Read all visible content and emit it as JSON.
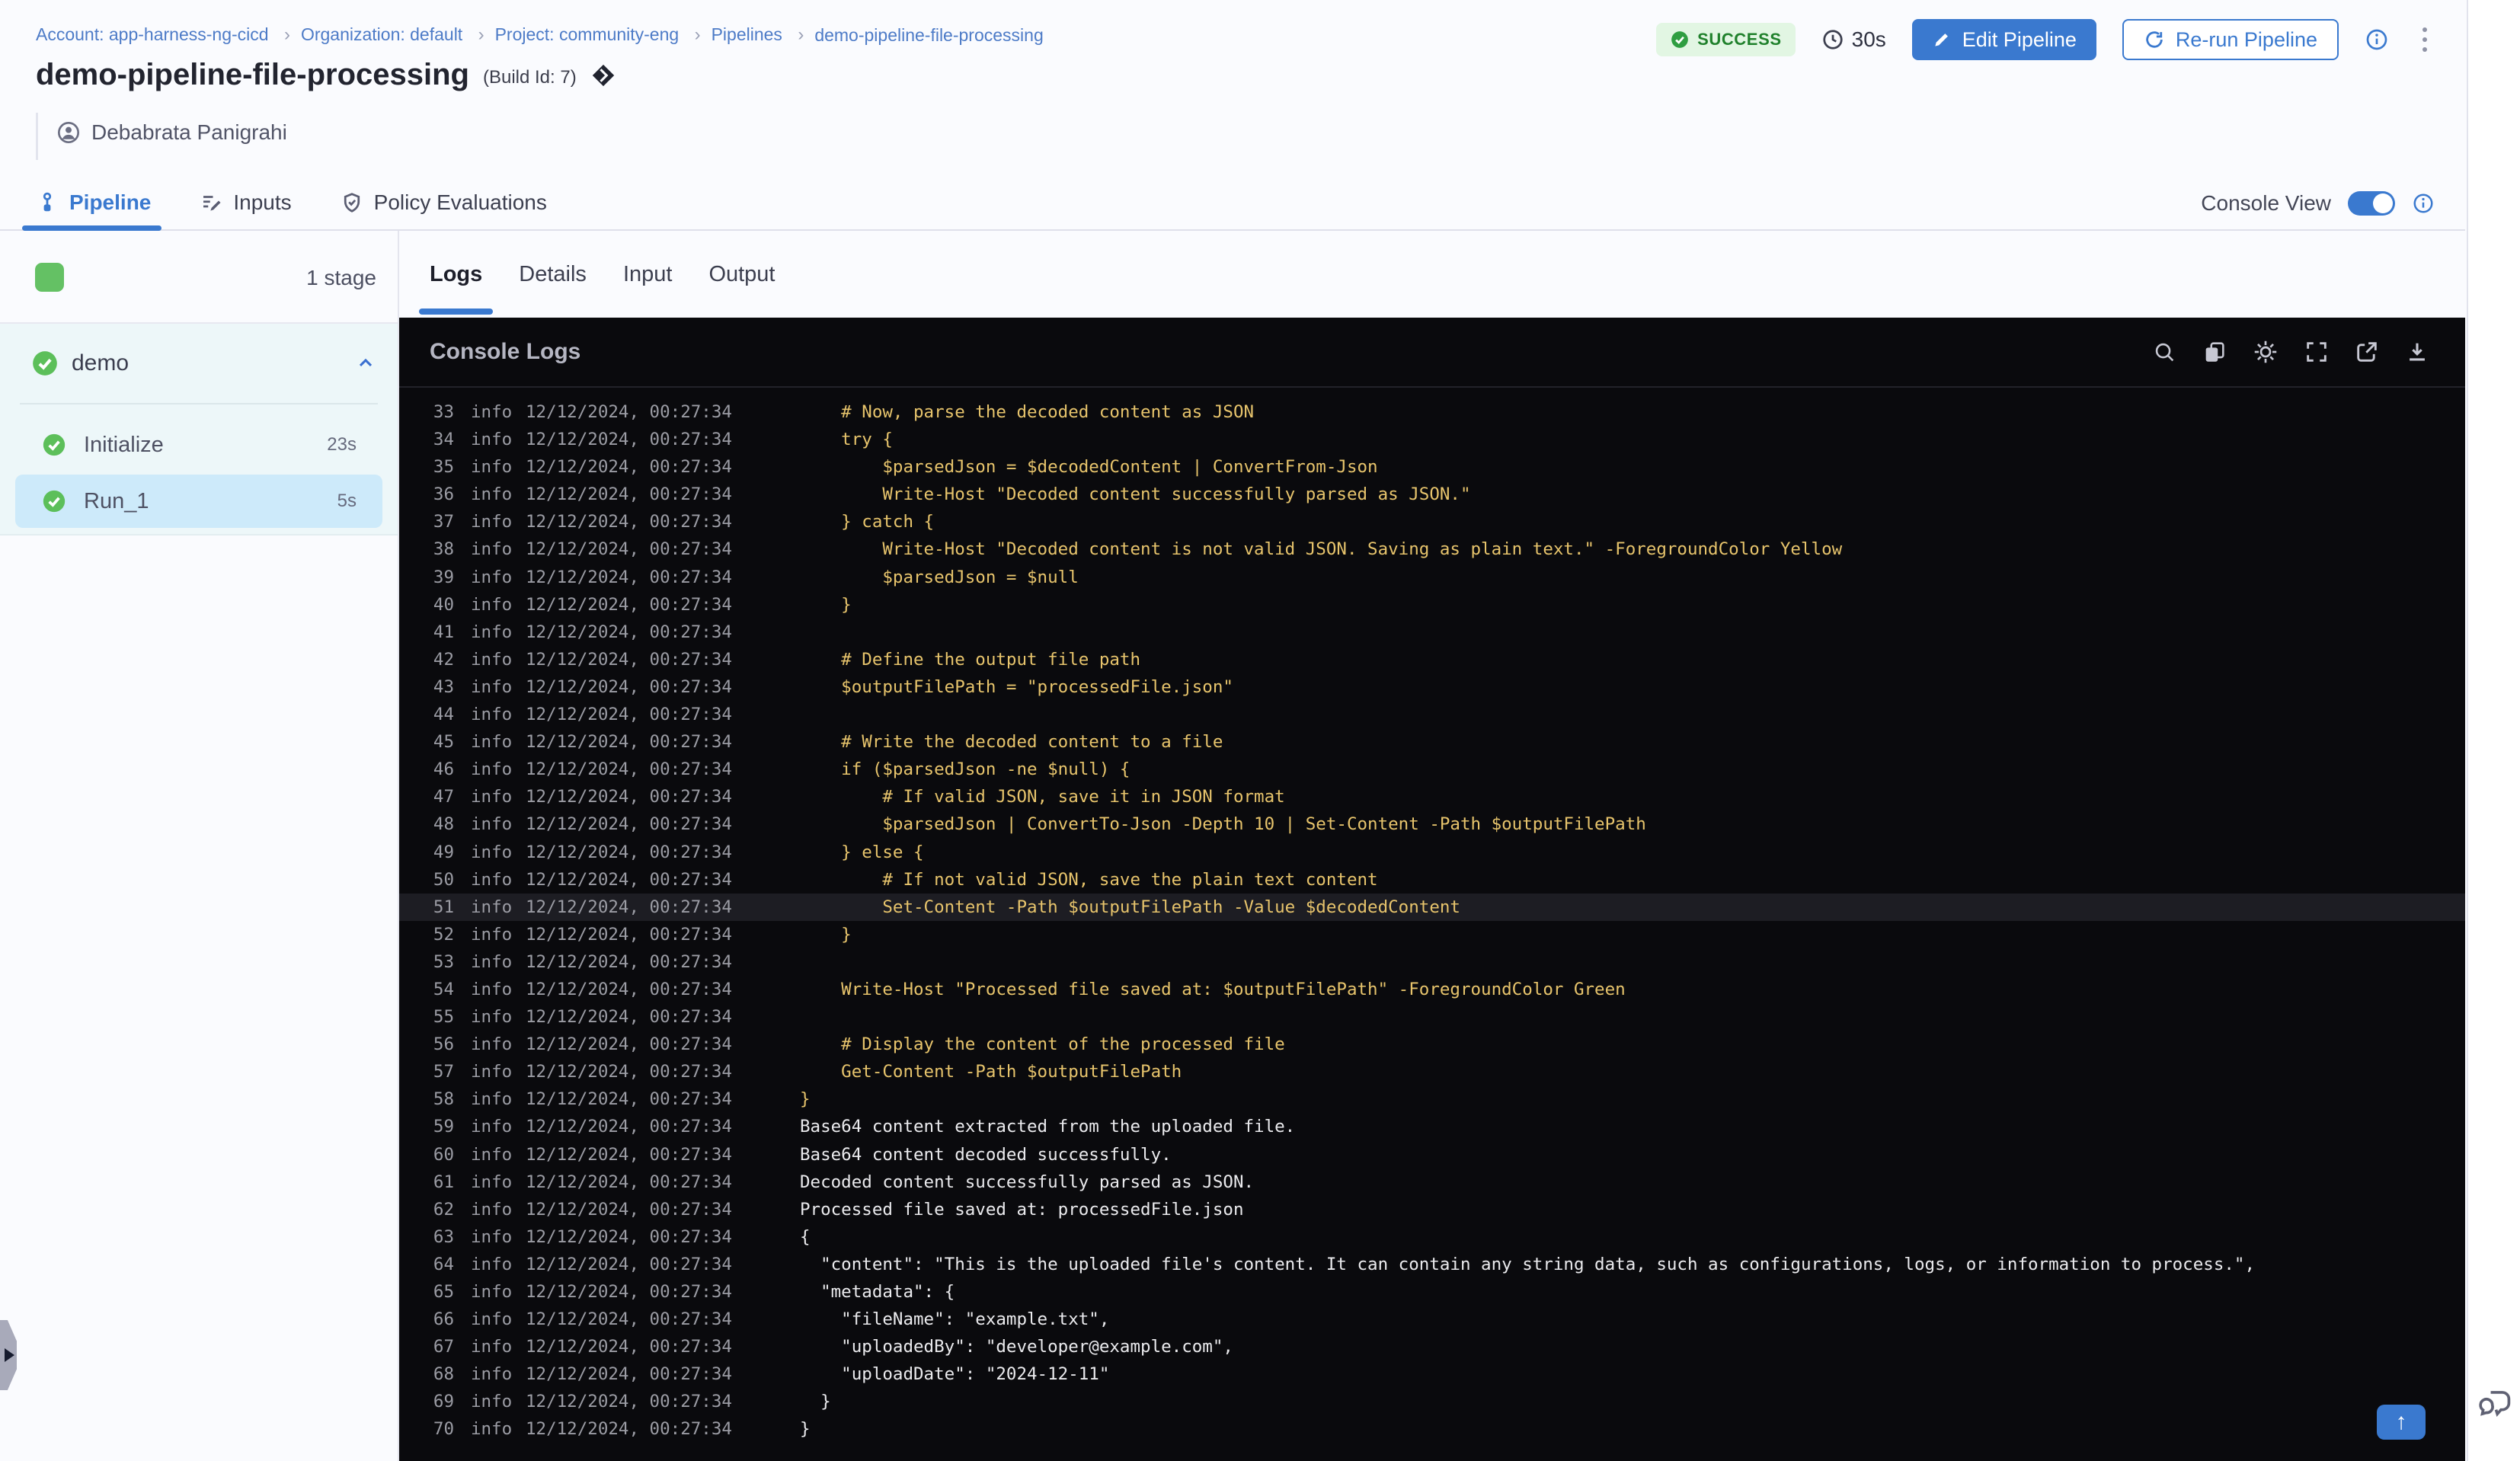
{
  "colors": {
    "primary": "#3a79cf",
    "success_bg": "#e2f6e3",
    "success_text": "#20812c",
    "console_bg": "#0a0a0d",
    "log_script": "#e7c46c",
    "log_output": "#ebebee"
  },
  "breadcrumb": {
    "separator": "›",
    "items": [
      "Account: app-harness-ng-cicd",
      "Organization: default",
      "Project: community-eng",
      "Pipelines",
      "demo-pipeline-file-processing"
    ]
  },
  "header": {
    "status": "SUCCESS",
    "duration": "30s",
    "edit_button": "Edit Pipeline",
    "rerun_button": "Re-run Pipeline",
    "title": "demo-pipeline-file-processing",
    "build_id": "(Build Id: 7)",
    "author": "Debabrata Panigrahi"
  },
  "nav_tabs": {
    "pipeline": "Pipeline",
    "inputs": "Inputs",
    "policy": "Policy Evaluations",
    "console_view_label": "Console View"
  },
  "sidebar": {
    "stage_count": "1 stage",
    "stage_name": "demo",
    "steps": [
      {
        "label": "Initialize",
        "duration": "23s",
        "state": ""
      },
      {
        "label": "Run_1",
        "duration": "5s",
        "state": "selected"
      }
    ]
  },
  "log_tabs": [
    {
      "label": "Logs",
      "cls": "active"
    },
    {
      "label": "Details",
      "cls": ""
    },
    {
      "label": "Input",
      "cls": ""
    },
    {
      "label": "Output",
      "cls": ""
    }
  ],
  "console": {
    "title": "Console Logs",
    "scroll_top_arrow": "↑"
  },
  "logs": {
    "lines": [
      {
        "n": "33",
        "level": "info",
        "time": "12/12/2024, 00:27:34",
        "cls": "yellow",
        "msg": "    # Now, parse the decoded content as JSON"
      },
      {
        "n": "34",
        "level": "info",
        "time": "12/12/2024, 00:27:34",
        "cls": "yellow",
        "msg": "    try {"
      },
      {
        "n": "35",
        "level": "info",
        "time": "12/12/2024, 00:27:34",
        "cls": "yellow",
        "msg": "        $parsedJson = $decodedContent | ConvertFrom-Json"
      },
      {
        "n": "36",
        "level": "info",
        "time": "12/12/2024, 00:27:34",
        "cls": "yellow",
        "msg": "        Write-Host \"Decoded content successfully parsed as JSON.\""
      },
      {
        "n": "37",
        "level": "info",
        "time": "12/12/2024, 00:27:34",
        "cls": "yellow",
        "msg": "    } catch {"
      },
      {
        "n": "38",
        "level": "info",
        "time": "12/12/2024, 00:27:34",
        "cls": "yellow",
        "msg": "        Write-Host \"Decoded content is not valid JSON. Saving as plain text.\" -ForegroundColor Yellow"
      },
      {
        "n": "39",
        "level": "info",
        "time": "12/12/2024, 00:27:34",
        "cls": "yellow",
        "msg": "        $parsedJson = $null"
      },
      {
        "n": "40",
        "level": "info",
        "time": "12/12/2024, 00:27:34",
        "cls": "yellow",
        "msg": "    }"
      },
      {
        "n": "41",
        "level": "info",
        "time": "12/12/2024, 00:27:34",
        "cls": "yellow",
        "msg": ""
      },
      {
        "n": "42",
        "level": "info",
        "time": "12/12/2024, 00:27:34",
        "cls": "yellow",
        "msg": "    # Define the output file path"
      },
      {
        "n": "43",
        "level": "info",
        "time": "12/12/2024, 00:27:34",
        "cls": "yellow",
        "msg": "    $outputFilePath = \"processedFile.json\""
      },
      {
        "n": "44",
        "level": "info",
        "time": "12/12/2024, 00:27:34",
        "cls": "yellow",
        "msg": ""
      },
      {
        "n": "45",
        "level": "info",
        "time": "12/12/2024, 00:27:34",
        "cls": "yellow",
        "msg": "    # Write the decoded content to a file"
      },
      {
        "n": "46",
        "level": "info",
        "time": "12/12/2024, 00:27:34",
        "cls": "yellow",
        "msg": "    if ($parsedJson -ne $null) {"
      },
      {
        "n": "47",
        "level": "info",
        "time": "12/12/2024, 00:27:34",
        "cls": "yellow",
        "msg": "        # If valid JSON, save it in JSON format"
      },
      {
        "n": "48",
        "level": "info",
        "time": "12/12/2024, 00:27:34",
        "cls": "yellow",
        "msg": "        $parsedJson | ConvertTo-Json -Depth 10 | Set-Content -Path $outputFilePath"
      },
      {
        "n": "49",
        "level": "info",
        "time": "12/12/2024, 00:27:34",
        "cls": "yellow",
        "msg": "    } else {"
      },
      {
        "n": "50",
        "level": "info",
        "time": "12/12/2024, 00:27:34",
        "cls": "yellow",
        "msg": "        # If not valid JSON, save the plain text content"
      },
      {
        "n": "51",
        "level": "info",
        "time": "12/12/2024, 00:27:34",
        "cls": "yellow highlight",
        "msg": "        Set-Content -Path $outputFilePath -Value $decodedContent"
      },
      {
        "n": "52",
        "level": "info",
        "time": "12/12/2024, 00:27:34",
        "cls": "yellow",
        "msg": "    }"
      },
      {
        "n": "53",
        "level": "info",
        "time": "12/12/2024, 00:27:34",
        "cls": "yellow",
        "msg": ""
      },
      {
        "n": "54",
        "level": "info",
        "time": "12/12/2024, 00:27:34",
        "cls": "yellow",
        "msg": "    Write-Host \"Processed file saved at: $outputFilePath\" -ForegroundColor Green"
      },
      {
        "n": "55",
        "level": "info",
        "time": "12/12/2024, 00:27:34",
        "cls": "yellow",
        "msg": ""
      },
      {
        "n": "56",
        "level": "info",
        "time": "12/12/2024, 00:27:34",
        "cls": "yellow",
        "msg": "    # Display the content of the processed file"
      },
      {
        "n": "57",
        "level": "info",
        "time": "12/12/2024, 00:27:34",
        "cls": "yellow",
        "msg": "    Get-Content -Path $outputFilePath"
      },
      {
        "n": "58",
        "level": "info",
        "time": "12/12/2024, 00:27:34",
        "cls": "yellow",
        "msg": "}"
      },
      {
        "n": "59",
        "level": "info",
        "time": "12/12/2024, 00:27:34",
        "cls": "white",
        "msg": "Base64 content extracted from the uploaded file."
      },
      {
        "n": "60",
        "level": "info",
        "time": "12/12/2024, 00:27:34",
        "cls": "white",
        "msg": "Base64 content decoded successfully."
      },
      {
        "n": "61",
        "level": "info",
        "time": "12/12/2024, 00:27:34",
        "cls": "white",
        "msg": "Decoded content successfully parsed as JSON."
      },
      {
        "n": "62",
        "level": "info",
        "time": "12/12/2024, 00:27:34",
        "cls": "white",
        "msg": "Processed file saved at: processedFile.json"
      },
      {
        "n": "63",
        "level": "info",
        "time": "12/12/2024, 00:27:34",
        "cls": "white",
        "msg": "{"
      },
      {
        "n": "64",
        "level": "info",
        "time": "12/12/2024, 00:27:34",
        "cls": "white",
        "msg": "  \"content\": \"This is the uploaded file's content. It can contain any string data, such as configurations, logs, or information to process.\","
      },
      {
        "n": "65",
        "level": "info",
        "time": "12/12/2024, 00:27:34",
        "cls": "white",
        "msg": "  \"metadata\": {"
      },
      {
        "n": "66",
        "level": "info",
        "time": "12/12/2024, 00:27:34",
        "cls": "white",
        "msg": "    \"fileName\": \"example.txt\","
      },
      {
        "n": "67",
        "level": "info",
        "time": "12/12/2024, 00:27:34",
        "cls": "white",
        "msg": "    \"uploadedBy\": \"developer@example.com\","
      },
      {
        "n": "68",
        "level": "info",
        "time": "12/12/2024, 00:27:34",
        "cls": "white",
        "msg": "    \"uploadDate\": \"2024-12-11\""
      },
      {
        "n": "69",
        "level": "info",
        "time": "12/12/2024, 00:27:34",
        "cls": "white",
        "msg": "  }"
      },
      {
        "n": "70",
        "level": "info",
        "time": "12/12/2024, 00:27:34",
        "cls": "white",
        "msg": "}"
      }
    ]
  }
}
